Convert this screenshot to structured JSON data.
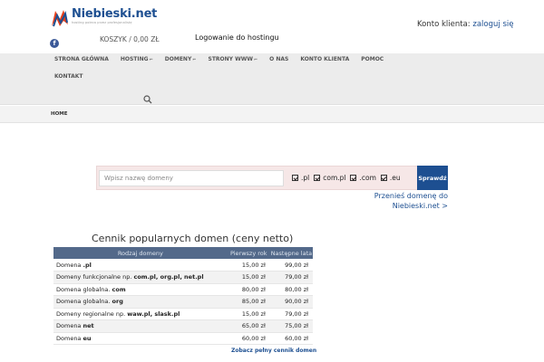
{
  "header": {
    "logo_name": "Niebieski.net",
    "logo_tagline": "hosting poleca przez profesjonalistę",
    "facebook_glyph": "f",
    "cart_label": "KOSZYK / 0,00 ZŁ",
    "hosting_login": "Logowanie do hostingu",
    "account_prefix": "Konto klienta:",
    "account_link": "zaloguj się"
  },
  "nav": {
    "items": [
      "STRONA GŁÓWNA",
      "HOSTING",
      "DOMENY",
      "STRONY WWW",
      "O NAS",
      "KONTO KLIENTA",
      "POMOC"
    ],
    "row2": "KONTAKT"
  },
  "breadcrumb": "HOME",
  "domain_search": {
    "placeholder": "Wpisz nazwę domeny",
    "tlds": [
      ".pl",
      "com.pl",
      ".com",
      ".eu"
    ],
    "button": "Sprawdź",
    "transfer_line1": "Przenieś domenę do",
    "transfer_line2": "Niebieski.net >"
  },
  "price_table": {
    "title": "Cennik popularnych domen (ceny netto)",
    "headers": [
      "Rodzaj domeny",
      "Pierwszy rok",
      "Następne lata"
    ],
    "rows": [
      {
        "pre": "Domena ",
        "bold": ".pl",
        "first": "15,00 zł",
        "next": "99,00 zł"
      },
      {
        "pre": "Domeny funkcjonalne np. ",
        "bold": "com.pl, org.pl, net.pl",
        "first": "15,00 zł",
        "next": "79,00 zł"
      },
      {
        "pre": "Domena globalna. ",
        "bold": "com",
        "first": "80,00 zł",
        "next": "80,00 zł"
      },
      {
        "pre": "Domena globalna. ",
        "bold": "org",
        "first": "85,00 zł",
        "next": "90,00 zł"
      },
      {
        "pre": "Domeny regionalne np. ",
        "bold": "waw.pl, slask.pl",
        "first": "15,00 zł",
        "next": "79,00 zł"
      },
      {
        "pre": "Domena ",
        "bold": "net",
        "first": "65,00 zł",
        "next": "75,00 zł"
      },
      {
        "pre": "Domena ",
        "bold": "eu",
        "first": "60,00 zł",
        "next": "60,00 zł"
      }
    ],
    "full_price_link": "Zobacz pełny cennik domen"
  },
  "colors": {
    "brand_blue": "#1d4f91",
    "table_header": "#53698a",
    "nav_bg": "#ececec",
    "search_bg": "#f6e7e7"
  }
}
